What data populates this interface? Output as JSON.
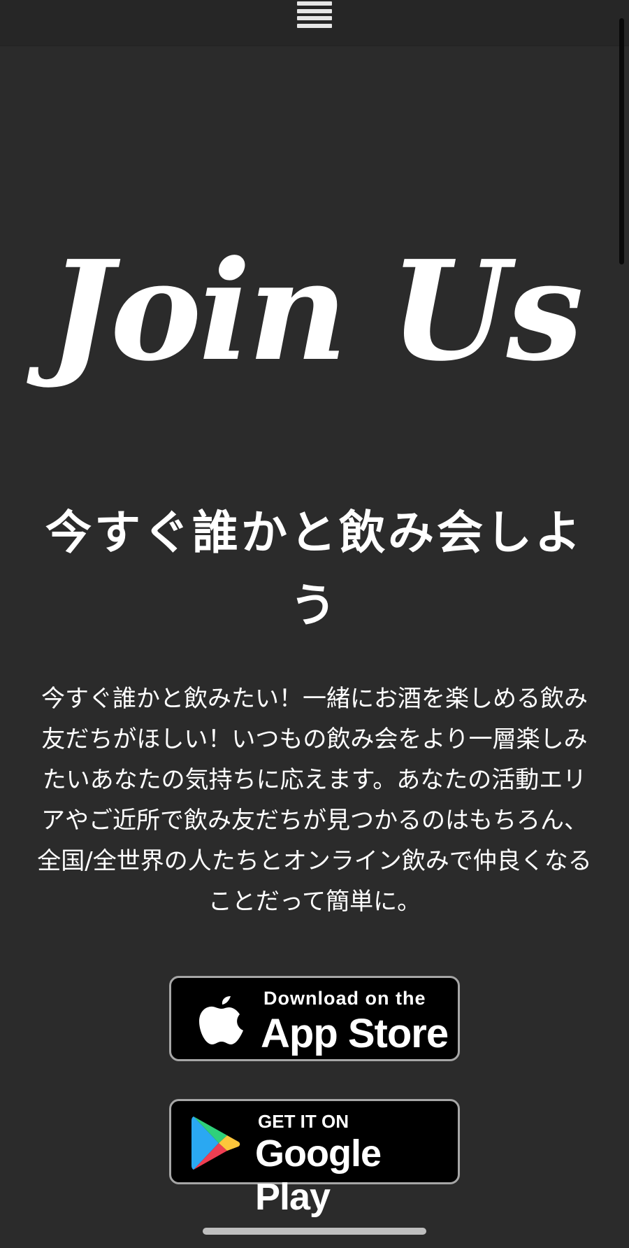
{
  "header": {
    "menu_icon": "hamburger-menu-icon"
  },
  "hero": {
    "title": "Join Us"
  },
  "headline": "今すぐ誰かと飲み会しよう",
  "description": "今すぐ誰かと飲みたい！一緒にお酒を楽しめる飲み友だちがほしい！いつもの飲み会をより一層楽しみたいあなたの気持ちに応えます。あなたの活動エリアやご近所で飲み友だちが見つかるのはもちろん、全国/全世界の人たちとオンライン飲みで仲良くなることだって簡単に。",
  "stores": {
    "app_store": {
      "small": "Download on the",
      "big": "App Store",
      "icon": "apple-logo-icon"
    },
    "google_play": {
      "small": "GET IT ON",
      "big": "Google Play",
      "icon": "google-play-logo-icon"
    }
  },
  "colors": {
    "background": "#2b2b2b",
    "topbar": "#262626",
    "badge_background": "#000000",
    "badge_border": "#a6a6a6",
    "text": "#ffffff"
  }
}
